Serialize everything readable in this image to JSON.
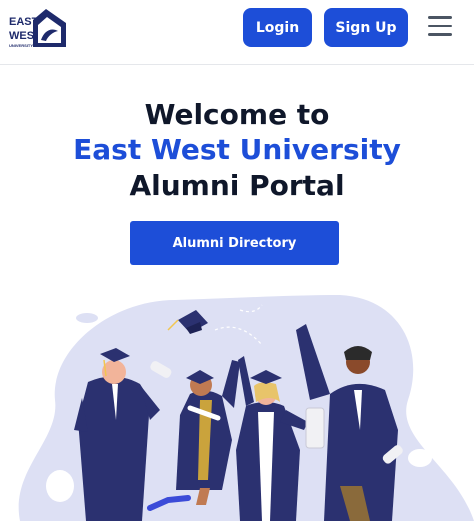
{
  "header": {
    "logo_text": [
      "EAST",
      "WEST",
      "UNIVERSITY"
    ],
    "login_label": "Login",
    "signup_label": "Sign Up",
    "menu_icon": "hamburger-menu-icon"
  },
  "hero": {
    "line1": "Welcome to",
    "line2": "East West University",
    "line3": "Alumni Portal",
    "cta_label": "Alumni Directory"
  },
  "colors": {
    "primary": "#1d4ed8",
    "heading": "#0f172a",
    "blob": "#dde0f4",
    "gown": "#2b3170"
  }
}
